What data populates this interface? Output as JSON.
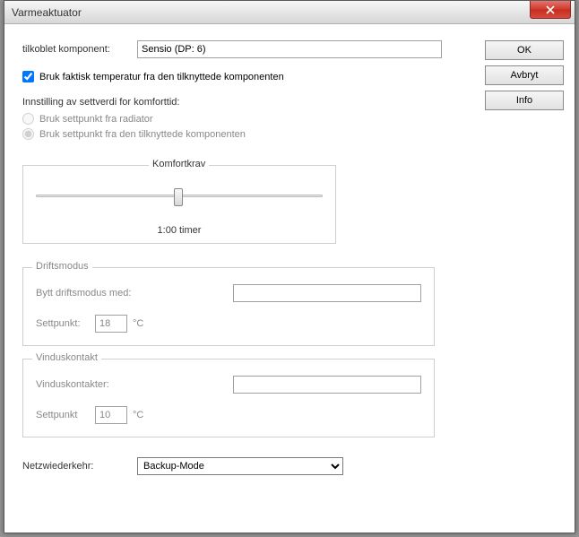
{
  "window": {
    "title": "Varmeaktuator"
  },
  "buttons": {
    "ok": "OK",
    "cancel": "Avbryt",
    "info": "Info"
  },
  "fields": {
    "connected_label": "tilkoblet komponent:",
    "connected_value": "Sensio (DP: 6)",
    "use_actual_temp": "Bruk faktisk temperatur fra den tilknyttede komponenten",
    "setpoint_section": "Innstilling av settverdi for komforttid:",
    "radio_radiator": "Bruk settpunkt fra radiator",
    "radio_component": "Bruk settpunkt fra den tilknyttede komponenten"
  },
  "komfort": {
    "legend": "Komfortkrav",
    "value_display": "1:00 timer"
  },
  "driftsmodus": {
    "legend": "Driftsmodus",
    "switch_label": "Bytt driftsmodus med:",
    "switch_value": "",
    "setpoint_label": "Settpunkt:",
    "setpoint_value": "18",
    "unit": "°C"
  },
  "vinduskontakt": {
    "legend": "Vinduskontakt",
    "contacts_label": "Vinduskontakter:",
    "contacts_value": "",
    "setpoint_label": "Settpunkt",
    "setpoint_value": "10",
    "unit": "°C"
  },
  "netz": {
    "label": "Netzwiederkehr:",
    "value": "Backup-Mode"
  }
}
